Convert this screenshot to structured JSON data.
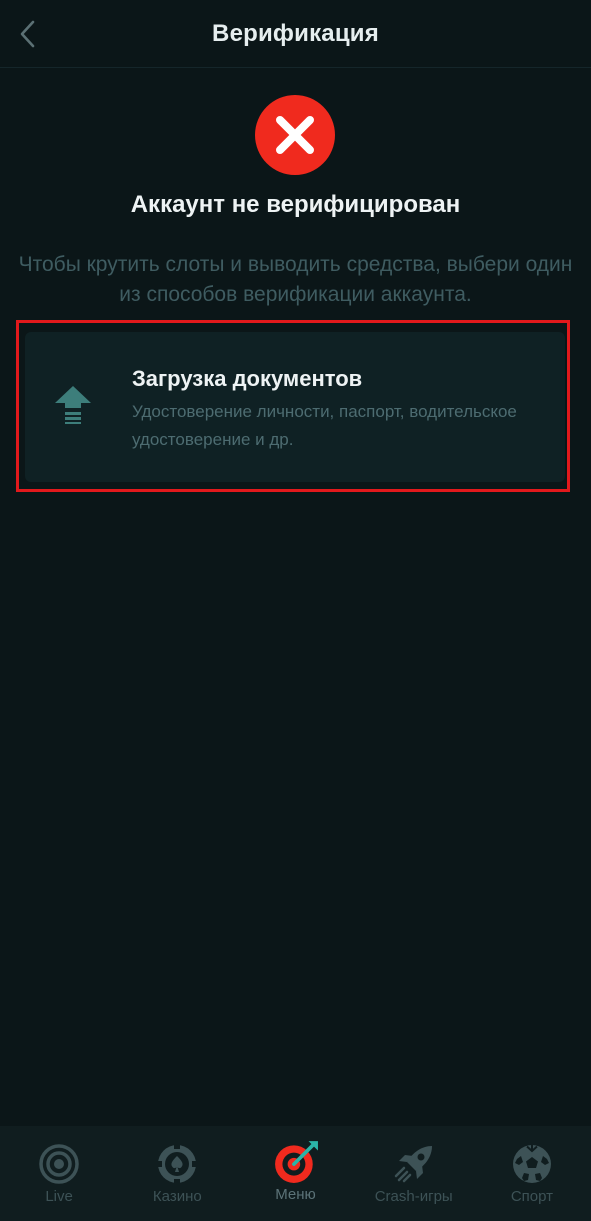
{
  "header": {
    "title": "Верификация",
    "back_icon": "chevron-left-icon"
  },
  "status": {
    "icon": "error-x-icon",
    "title": "Аккаунт не верифицирован",
    "description": "Чтобы крутить слоты и выводить средства, выбери один из способов верификации аккаунта.",
    "icon_color": "#f02a1e"
  },
  "document_upload": {
    "icon": "upload-arrow-icon",
    "title": "Загрузка документов",
    "subtitle": "Удостоверение личности, паспорт, водительское удостоверение и др.",
    "highlight_color": "#e2191c"
  },
  "bottom_nav": {
    "items": [
      {
        "label": "Live",
        "icon": "live-target-icon"
      },
      {
        "label": "Казино",
        "icon": "casino-chip-icon"
      },
      {
        "label": "Меню",
        "icon": "dart-target-icon",
        "active": true
      },
      {
        "label": "Crash-игры",
        "icon": "rocket-icon"
      },
      {
        "label": "Спорт",
        "icon": "soccer-ball-icon"
      }
    ]
  },
  "colors": {
    "background": "#0b1618",
    "card": "#0f2124",
    "muted_text": "#3f5c61",
    "accent_red": "#f02a1e",
    "accent_teal": "#2bb5a8"
  }
}
